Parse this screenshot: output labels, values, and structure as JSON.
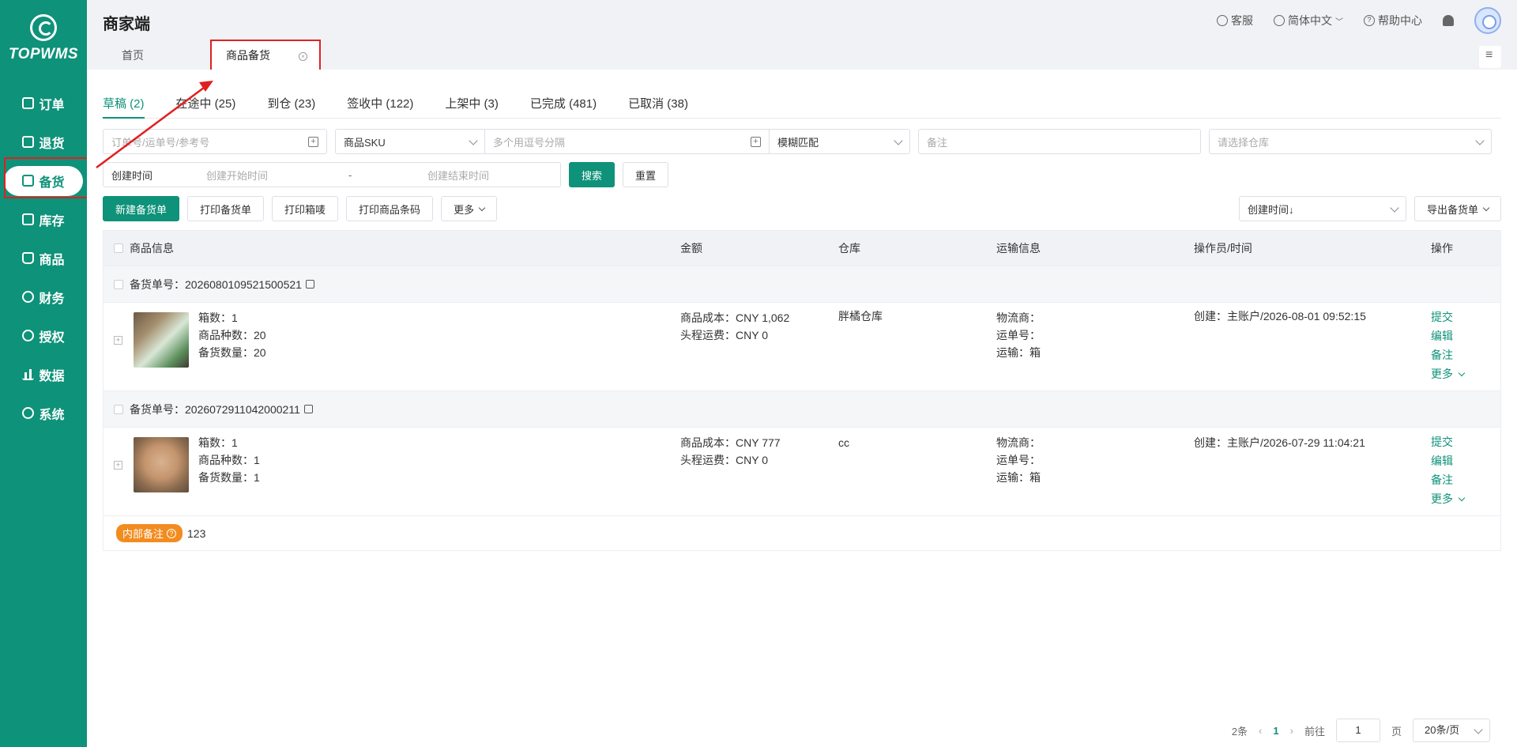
{
  "brand": {
    "name": "TOPWMS",
    "primary": "#0e9279"
  },
  "sidebar": {
    "items": [
      {
        "label": "订单",
        "icon": "order-icon"
      },
      {
        "label": "退货",
        "icon": "return-icon"
      },
      {
        "label": "备货",
        "icon": "stock-prep-icon",
        "active": true
      },
      {
        "label": "库存",
        "icon": "inventory-icon"
      },
      {
        "label": "商品",
        "icon": "product-icon"
      },
      {
        "label": "财务",
        "icon": "finance-icon"
      },
      {
        "label": "授权",
        "icon": "auth-icon"
      },
      {
        "label": "数据",
        "icon": "data-icon"
      },
      {
        "label": "系统",
        "icon": "system-icon"
      }
    ]
  },
  "header": {
    "title": "商家端",
    "service": "客服",
    "language": "简体中文",
    "help": "帮助中心"
  },
  "page_tabs": [
    {
      "label": "首页"
    },
    {
      "label": "商品备货",
      "active": true
    }
  ],
  "status_tabs": [
    {
      "label": "草稿 (2)",
      "active": true
    },
    {
      "label": "在途中 (25)"
    },
    {
      "label": "到仓 (23)"
    },
    {
      "label": "签收中 (122)"
    },
    {
      "label": "上架中 (3)"
    },
    {
      "label": "已完成 (481)"
    },
    {
      "label": "已取消 (38)"
    }
  ],
  "filters": {
    "order_placeholder": "订单号/运单号/参考号",
    "sku_select": "商品SKU",
    "sku_placeholder": "多个用逗号分隔",
    "match_select": "模糊匹配",
    "remark_placeholder": "备注",
    "warehouse_placeholder": "请选择仓库",
    "date_type": "创建时间",
    "date_start_placeholder": "创建开始时间",
    "date_sep": "-",
    "date_end_placeholder": "创建结束时间",
    "search": "搜索",
    "reset": "重置"
  },
  "toolbar": {
    "new": "新建备货单",
    "print_order": "打印备货单",
    "print_box": "打印箱唛",
    "print_barcode": "打印商品条码",
    "more": "更多",
    "sort": "创建时间↓",
    "export": "导出备货单"
  },
  "table": {
    "columns": [
      "商品信息",
      "金额",
      "仓库",
      "运输信息",
      "操作员/时间",
      "操作"
    ],
    "orders": [
      {
        "order_label": "备货单号：",
        "order_no": "2026080109521500521",
        "boxes": "箱数：1",
        "kinds": "商品种数：20",
        "qty": "备货数量：20",
        "cost": "商品成本：CNY 1,062",
        "freight": "头程运费：CNY 0",
        "warehouse": "胖橘仓库",
        "carrier": "物流商：",
        "tracking": "运单号：",
        "transport": "运输：箱",
        "created": "创建：主账户/2026-08-01 09:52:15",
        "actions": [
          "提交",
          "编辑",
          "备注",
          "更多"
        ]
      },
      {
        "order_label": "备货单号：",
        "order_no": "2026072911042000211",
        "boxes": "箱数：1",
        "kinds": "商品种数：1",
        "qty": "备货数量：1",
        "cost": "商品成本：CNY 777",
        "freight": "头程运费：CNY 0",
        "warehouse": "cc",
        "carrier": "物流商：",
        "tracking": "运单号：",
        "transport": "运输：箱",
        "created": "创建：主账户/2026-07-29 11:04:21",
        "actions": [
          "提交",
          "编辑",
          "备注",
          "更多"
        ]
      }
    ],
    "internal_note_label": "内部备注",
    "internal_note_value": "123"
  },
  "pagination": {
    "total": "2条",
    "current": "1",
    "goto": "前往",
    "page_input": "1",
    "page_unit": "页",
    "page_size": "20条/页"
  }
}
